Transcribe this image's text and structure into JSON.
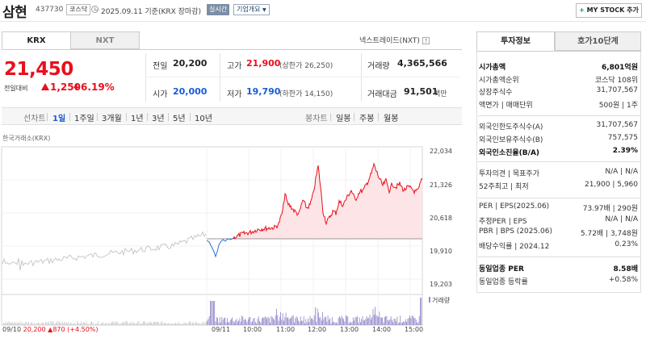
{
  "header": {
    "stock_name": "삼현",
    "stock_code": "437730",
    "market_badge": "코스닥",
    "date_text": "2025.09.11 기준(KRX 장마감)",
    "realtime_label": "실시간",
    "company_overview_label": "기업개요",
    "mystock_label": "MY STOCK 추가"
  },
  "market_tabs": [
    "KRX",
    "NXT"
  ],
  "nextrade_label": "넥스트레이드(NXT)",
  "quote": {
    "price": "21,450",
    "change_label": "전일대비",
    "change_value": "1,250",
    "change_pct": "+6.19%",
    "prev_close_label": "전일",
    "prev_close": "20,200",
    "open_label": "시가",
    "open": "20,000",
    "high_label": "고가",
    "high": "21,900",
    "upper_limit": "(상한가 26,250)",
    "low_label": "저가",
    "low": "19,790",
    "lower_limit": "(하한가 14,150)",
    "volume_label": "거래량",
    "volume": "4,365,566",
    "amount_label": "거래대금",
    "amount": "91,501",
    "amount_unit": "백만"
  },
  "period": {
    "line_label": "선차트",
    "line_items": [
      "1일",
      "1주일",
      "3개월",
      "1년",
      "3년",
      "5년",
      "10년"
    ],
    "active": "1일",
    "candle_label": "봉차트",
    "candle_items": [
      "일봉",
      "주봉",
      "월봉"
    ]
  },
  "chart_data": {
    "type": "line",
    "title": "",
    "source_label": "한국거래소(KRX)",
    "y_ticks": [
      "22,034",
      "21,326",
      "20,618",
      "19,910",
      "19,203"
    ],
    "ylim": [
      19203,
      22034
    ],
    "x_ticks": [
      "09/11",
      "10:00",
      "11:00",
      "12:00",
      "13:00",
      "14:00",
      "15:00"
    ],
    "reference_price": 20200,
    "volume_label": "거래량",
    "prev_day_summary": {
      "date": "09/10",
      "close": "20,200",
      "change": "870",
      "pct": "(+4.50%)"
    }
  },
  "right_panel": {
    "tabs": [
      "투자정보",
      "호가10단계"
    ],
    "rows_a": [
      {
        "label": "시가총액",
        "value": "6,801억원",
        "bold": true
      },
      {
        "label": "시가총액순위",
        "value": "코스닥 108위"
      },
      {
        "label": "상장주식수",
        "value": "31,707,567"
      },
      {
        "label": "액면가 | 매매단위",
        "value": "500원 | 1주"
      }
    ],
    "rows_b": [
      {
        "label": "외국인한도주식수(A)",
        "value": "31,707,567"
      },
      {
        "label": "외국인보유주식수(B)",
        "value": "757,575"
      },
      {
        "label": "외국인소진율(B/A)",
        "value": "2.39%",
        "bold": true
      }
    ],
    "rows_c": [
      {
        "label": "투자의견 | 목표주가",
        "value": "N/A | N/A"
      },
      {
        "label": "52주최고 | 최저",
        "value": "21,900 | 5,960"
      }
    ],
    "rows_d": [
      {
        "label": "PER | EPS(2025.06)",
        "value": "73.97배 | 290원"
      },
      {
        "label": "추정PER | EPS",
        "value": "N/A | N/A"
      },
      {
        "label": "PBR | BPS (2025.06)",
        "value": "5.72배 | 3,748원"
      },
      {
        "label": "배당수익률 | 2024.12",
        "value": "0.23%"
      }
    ],
    "rows_e": [
      {
        "label": "동일업종 PER",
        "value": "8.58배",
        "bold": true
      },
      {
        "label": "동일업종 등락률",
        "value": "+0.58%",
        "red": true
      }
    ]
  }
}
